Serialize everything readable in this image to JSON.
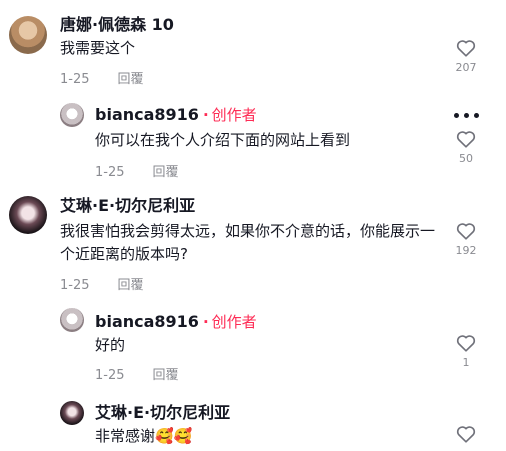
{
  "comments": [
    {
      "user": "唐娜·佩德森 10",
      "text": "我需要这个",
      "date": "1-25",
      "reply": "回覆",
      "likes": "207"
    },
    {
      "user": "bianca8916",
      "creator": "创作者",
      "text": "你可以在我个人介绍下面的网站上看到",
      "date": "1-25",
      "reply": "回覆",
      "likes": "50"
    },
    {
      "user": "艾琳·E·切尔尼利亚",
      "text": "我很害怕我会剪得太远，如果你不介意的话，你能展示一个近距离的版本吗?",
      "date": "1-25",
      "reply": "回覆",
      "likes": "192"
    },
    {
      "user": "bianca8916",
      "creator": "创作者",
      "text": "好的",
      "date": "1-25",
      "reply": "回覆",
      "likes": "1"
    },
    {
      "user": "艾琳·E·切尔尼利亚",
      "text": "非常感谢🥰🥰"
    }
  ],
  "icons": {
    "like": "heart-outline-icon",
    "more": "more-options-icon"
  },
  "colors": {
    "creator": "#fe2c55",
    "meta": "#8a8b91",
    "text": "#161823"
  }
}
